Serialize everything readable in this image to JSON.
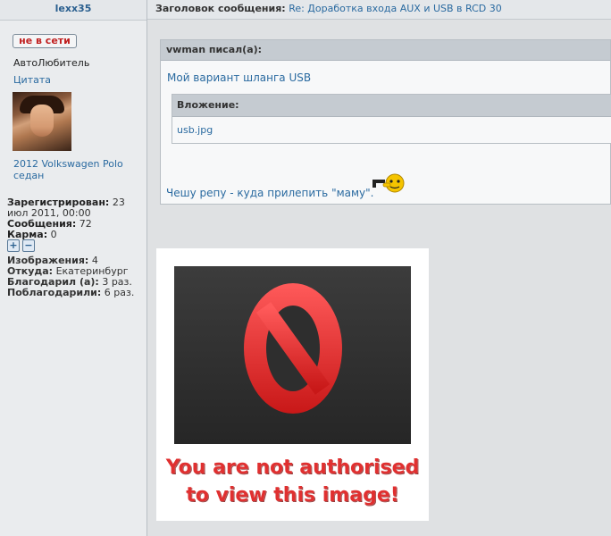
{
  "sidebar": {
    "username": "lexx35",
    "status_label": "не в сети",
    "rank": "АвтоЛюбитель",
    "quote_link": "Цитата",
    "car": "2012 Volkswagen Polo седан",
    "stats": {
      "registered_label": "Зарегистрирован:",
      "registered_value": "23 июл 2011, 00:00",
      "posts_label": "Сообщения:",
      "posts_value": "72",
      "karma_label": "Карма:",
      "karma_value": "0",
      "karma_plus": "+",
      "karma_minus": "−",
      "images_label": "Изображения:",
      "images_value": "4",
      "from_label": "Откуда:",
      "from_value": "Екатеринбург",
      "thanked_label": "Благодарил (а):",
      "thanked_value": "3 раз.",
      "was_thanked_label": "Поблагодарили:",
      "was_thanked_value": "6 раз."
    }
  },
  "post": {
    "subject_label": "Заголовок сообщения:",
    "subject": "Re: Доработка входа AUX и USB в RCD 30",
    "quote": {
      "author": "vwman писал(а):",
      "text": "Мой вариант шланга USB",
      "attachment_label": "Вложение:",
      "attachment_file": "usb.jpg"
    },
    "reply_text": "Чешу репу - куда прилепить \"маму\".",
    "smiley_icon": "shooting-smiley-icon",
    "blocked_image": {
      "line1": "You are not authorised",
      "line2": "to view this image!"
    }
  },
  "colors": {
    "link": "#2a6aa0",
    "status_red": "#c02020",
    "blocked_red": "#e03030"
  }
}
